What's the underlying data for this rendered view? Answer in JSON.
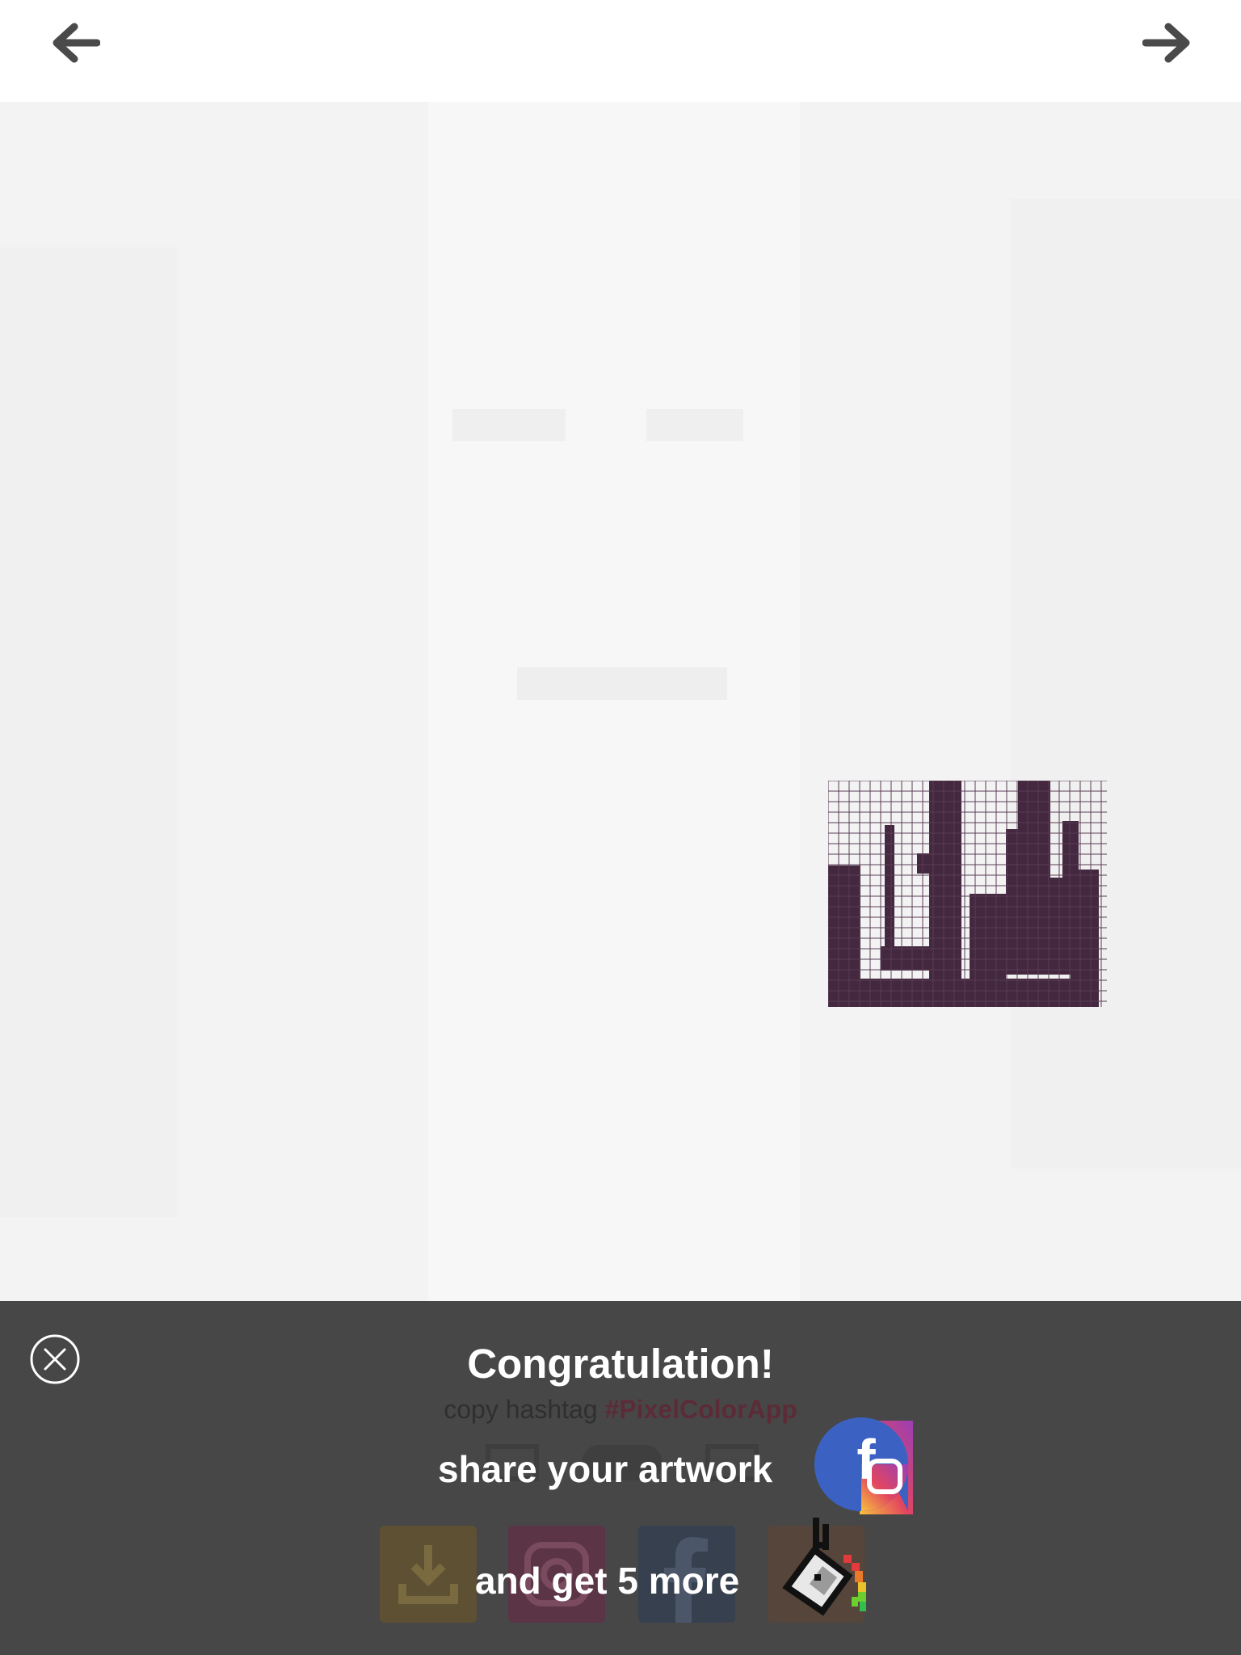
{
  "topbar": {
    "back_icon": "arrow-left-icon",
    "next_icon": "arrow-right-icon"
  },
  "artwork": {
    "filled_color": "#43283f",
    "unfilled_color": "#f4f4f4"
  },
  "panel": {
    "close_icon": "close-circle-icon",
    "title": "Congratulation!",
    "hashtag_prefix": "copy hashtag",
    "hashtag": "#PixelColorApp",
    "share_text": "share your artwork",
    "share_icon": "facebook-instagram-icon",
    "reward_text": "and get 5 more",
    "reward_icon": "paint-bucket-icon",
    "actions": [
      {
        "name": "save",
        "icon": "download-icon",
        "color": "#5e5032"
      },
      {
        "name": "instagram",
        "icon": "instagram-icon",
        "color": "#5b3446"
      },
      {
        "name": "facebook",
        "icon": "facebook-icon",
        "color": "#36404f"
      },
      {
        "name": "more",
        "icon": "share-icon",
        "color": "#55453b"
      }
    ]
  }
}
